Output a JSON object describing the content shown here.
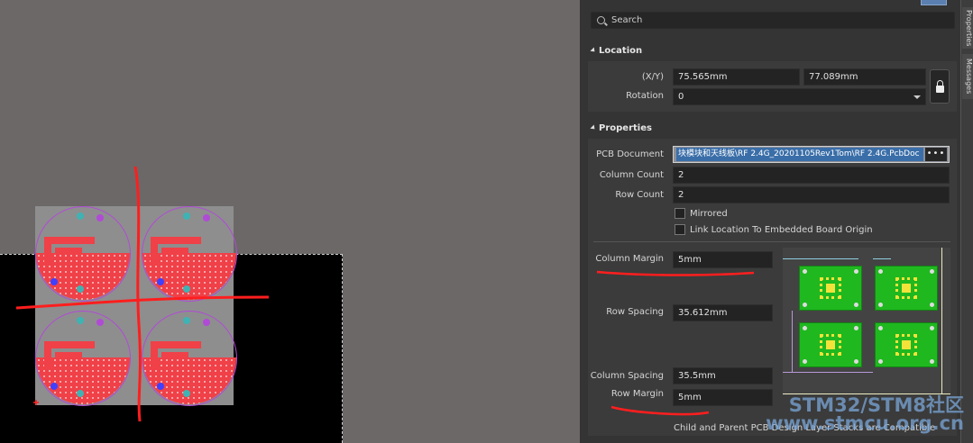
{
  "search": {
    "placeholder": "Search"
  },
  "location": {
    "header": "Location",
    "xy_label": "(X/Y)",
    "x_value": "75.565mm",
    "y_value": "77.089mm",
    "rotation_label": "Rotation",
    "rotation_value": "0"
  },
  "properties": {
    "header": "Properties",
    "pcb_document_label": "PCB Document",
    "pcb_document_value": "块模块和天线板\\RF 2.4G_20201105Rev1Tom\\RF 2.4G.PcbDoc",
    "pcb_document_button": "•••",
    "column_count_label": "Column Count",
    "column_count_value": "2",
    "row_count_label": "Row Count",
    "row_count_value": "2",
    "mirrored_label": "Mirrored",
    "mirrored_checked": false,
    "link_location_label": "Link Location To Embedded Board Origin",
    "link_location_checked": false,
    "column_margin_label": "Column Margin",
    "column_margin_value": "5mm",
    "row_spacing_label": "Row Spacing",
    "row_spacing_value": "35.612mm",
    "column_spacing_label": "Column Spacing",
    "column_spacing_value": "35.5mm",
    "row_margin_label": "Row Margin",
    "row_margin_value": "5mm",
    "compat_text": "Child and Parent PCB Design Layer Stacks are Compatible"
  },
  "side_tabs": [
    "Properties",
    "Messages"
  ],
  "watermark": {
    "line1": "STM32/STM8社区",
    "line2": "www.stmcu.org.cn"
  },
  "colors": {
    "panel_bg": "#343434",
    "field_bg": "#232323",
    "board_red": "#f04048",
    "annotation_red": "#ff1e1e",
    "mini_board_green": "#1fb81f"
  }
}
